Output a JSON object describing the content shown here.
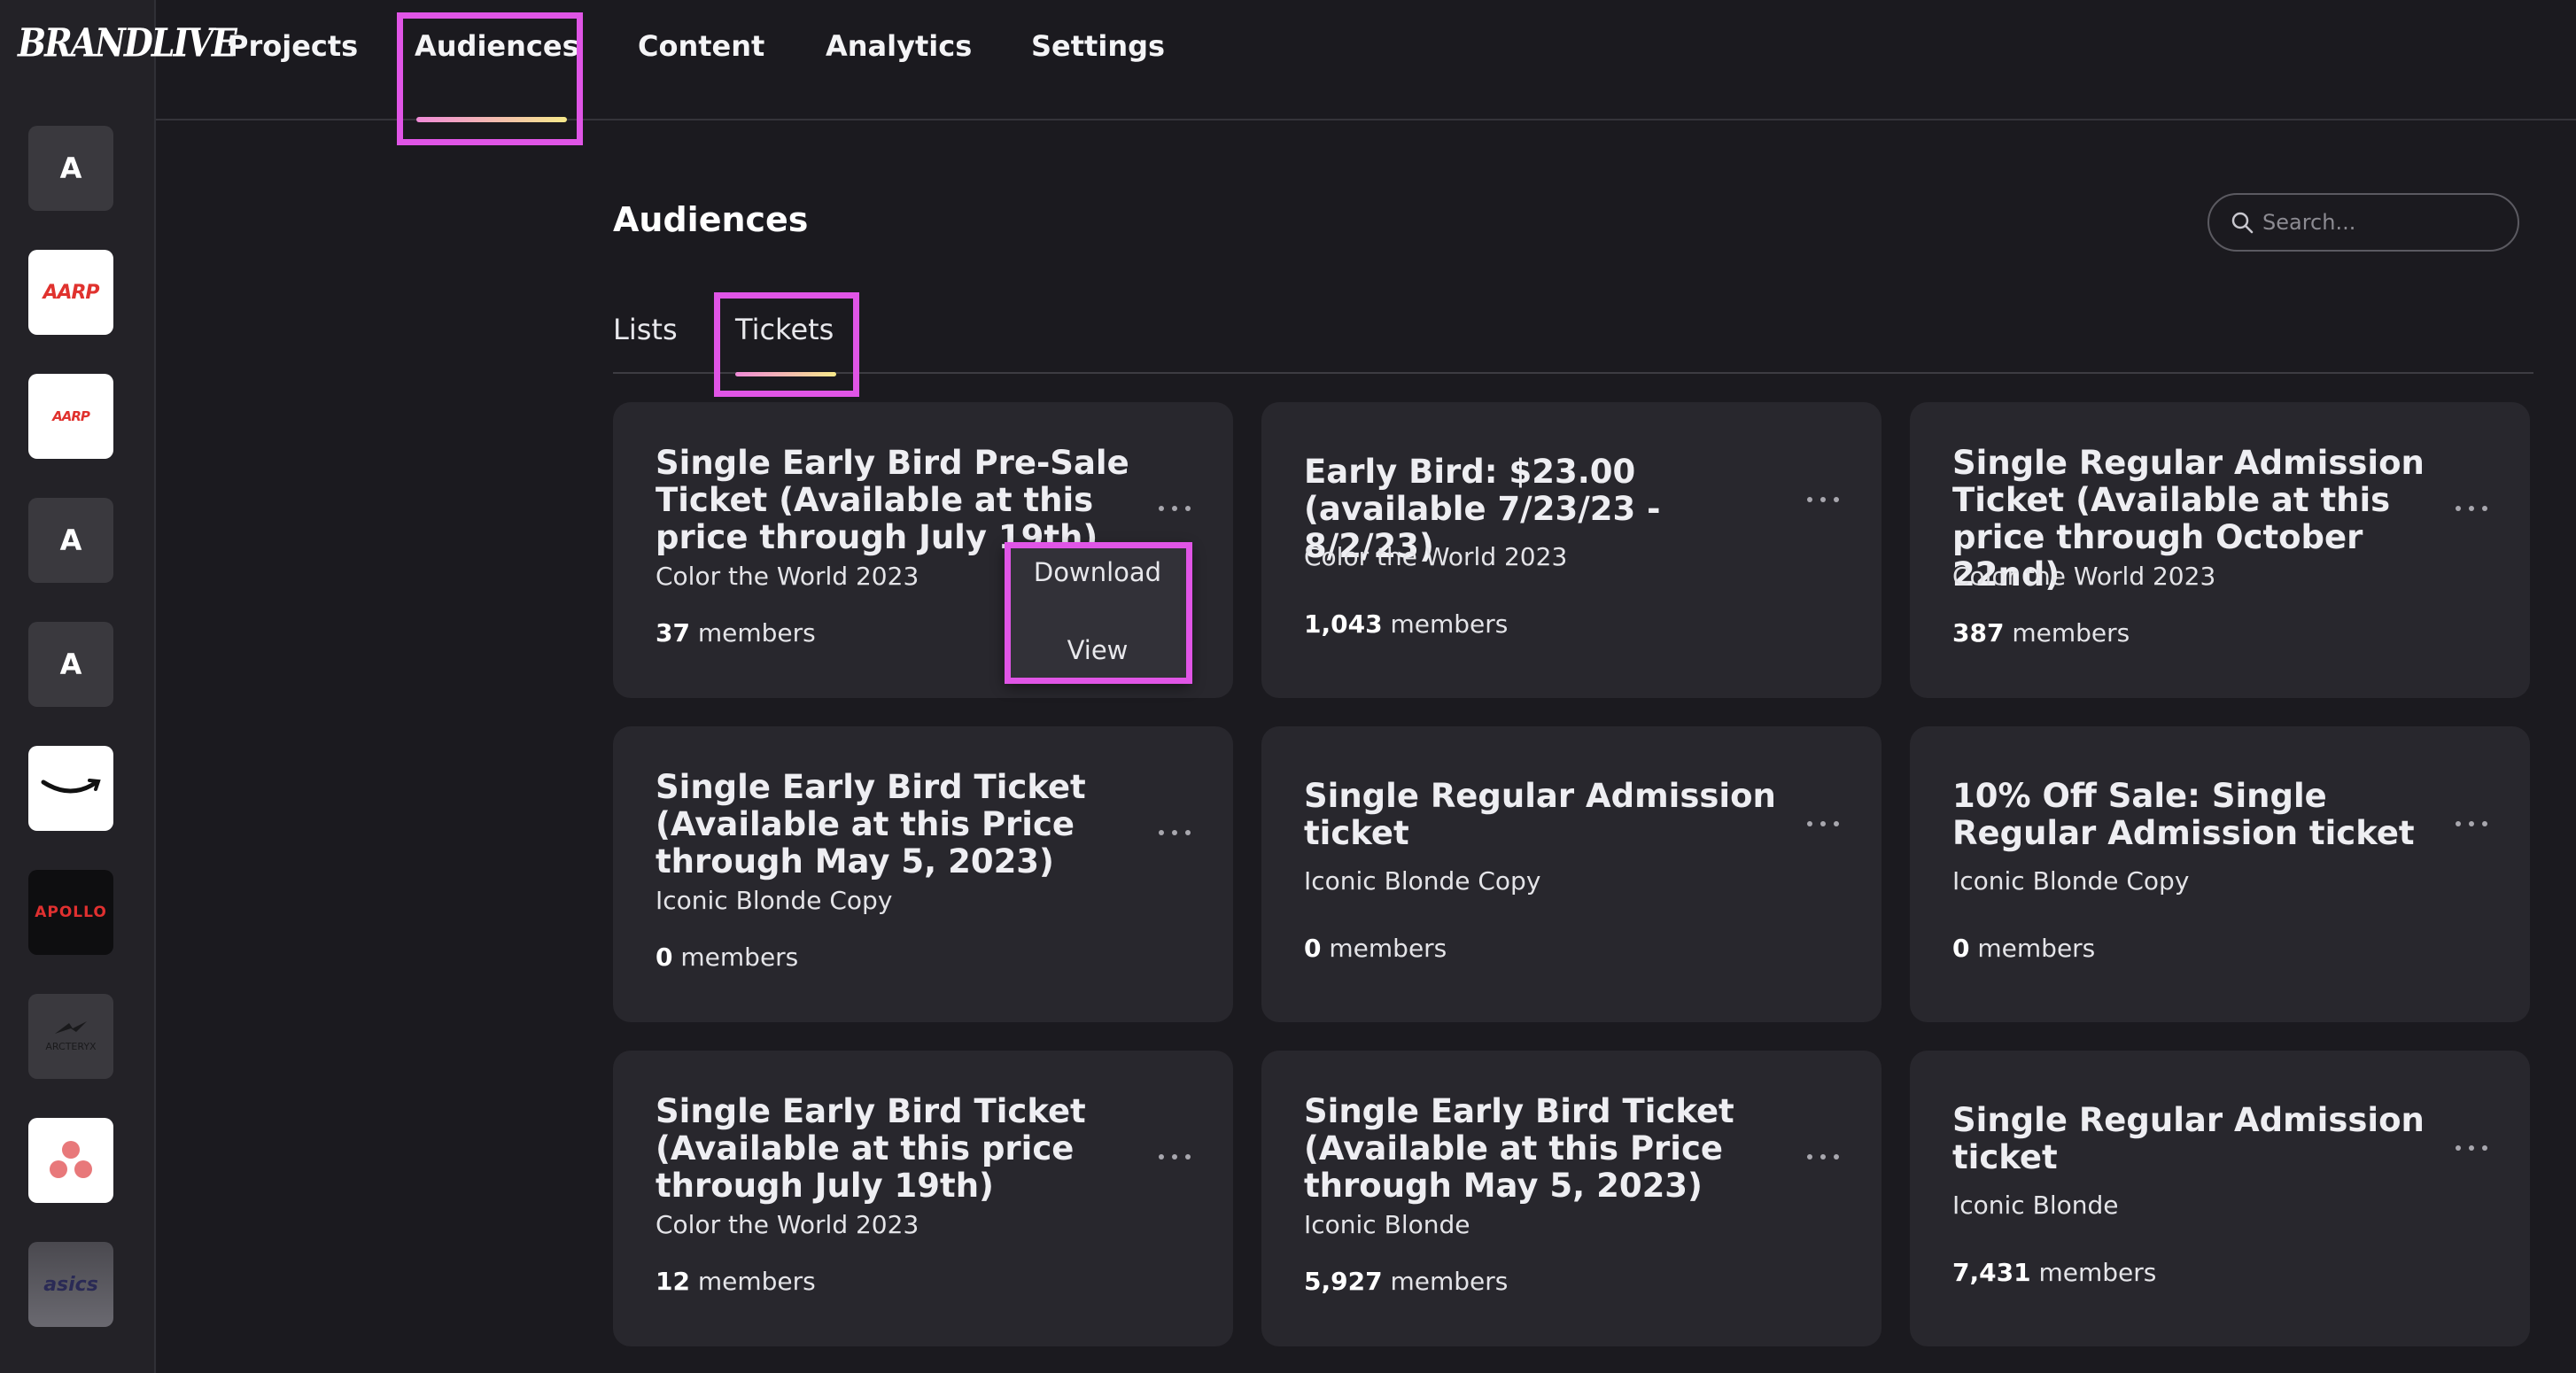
{
  "brand": "BRANDLIVE",
  "clients": [
    {
      "name": "A"
    },
    {
      "name": "AARP"
    },
    {
      "name": "AARP"
    },
    {
      "name": "A"
    },
    {
      "name": "A"
    },
    {
      "name": "amazon"
    },
    {
      "name": "APOLLO"
    },
    {
      "name": "ARCTERYX"
    },
    {
      "name": "asana"
    },
    {
      "name": "asics"
    }
  ],
  "nav": {
    "projects": "Projects",
    "audiences": "Audiences",
    "content": "Content",
    "analytics": "Analytics",
    "settings": "Settings"
  },
  "page": {
    "title": "Audiences",
    "search_placeholder": "Search..."
  },
  "tabs": {
    "lists": "Lists",
    "tickets": "Tickets"
  },
  "cards": [
    {
      "title": "Single Early Bird Pre-Sale Ticket (Available at this price through July 19th)",
      "project": "Color the World 2023",
      "count": "37",
      "unit": "members"
    },
    {
      "title": "Early Bird: $23.00 (available 7/23/23 - 8/2/23)",
      "project": "Color the World 2023",
      "count": "1,043",
      "unit": "members"
    },
    {
      "title": "Single Regular Admission Ticket (Available at this price through October 22nd)",
      "project": "Color the World 2023",
      "count": "387",
      "unit": "members"
    },
    {
      "title": "Single Early Bird Ticket (Available at this Price through May 5, 2023)",
      "project": "Iconic Blonde Copy",
      "count": "0",
      "unit": "members"
    },
    {
      "title": "Single Regular Admission ticket",
      "project": "Iconic Blonde Copy",
      "count": "0",
      "unit": "members"
    },
    {
      "title": "10% Off Sale: Single Regular Admission ticket",
      "project": "Iconic Blonde Copy",
      "count": "0",
      "unit": "members"
    },
    {
      "title": "Single Early Bird Ticket (Available at this price through July 19th)",
      "project": "Color the World 2023",
      "count": "12",
      "unit": "members"
    },
    {
      "title": "Single Early Bird Ticket (Available at this Price through May 5, 2023)",
      "project": "Iconic Blonde",
      "count": "5,927",
      "unit": "members"
    },
    {
      "title": "Single Regular Admission ticket",
      "project": "Iconic Blonde",
      "count": "7,431",
      "unit": "members"
    }
  ],
  "context_menu": {
    "download": "Download",
    "view": "View"
  },
  "colors": {
    "highlight": "#e055e6",
    "accent_gradient_start": "#f08ad8",
    "accent_gradient_end": "#f7e98a"
  }
}
